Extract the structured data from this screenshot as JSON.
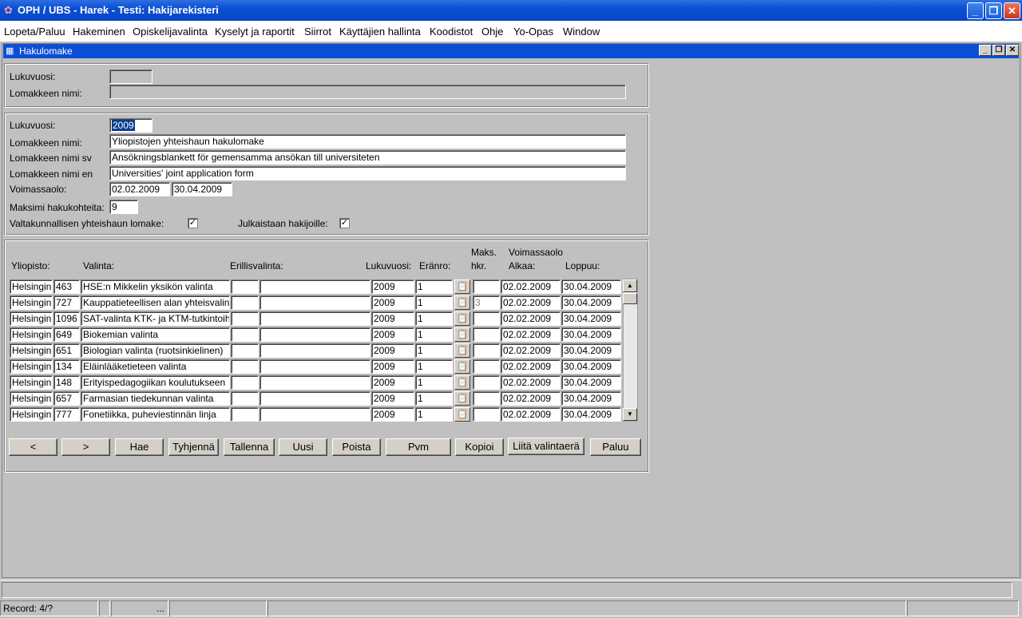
{
  "window": {
    "title": "OPH / UBS - Harek - Testi: Hakijarekisteri",
    "min_glyph": "_",
    "max_glyph": "❐",
    "close_glyph": "✕"
  },
  "menu": [
    "Lopeta/Paluu",
    "Hakeminen",
    "Opiskelijavalinta",
    "Kyselyt ja raportit",
    "Siirrot",
    "Käyttäjien hallinta",
    "Koodistot",
    "Ohje",
    "Yo-Opas",
    "Window"
  ],
  "form": {
    "title": "Hakulomake"
  },
  "search": {
    "lukuvuosi_label": "Lukuvuosi:",
    "lukuvuosi_value": "",
    "nimi_label": "Lomakkeen nimi:",
    "nimi_value": ""
  },
  "details": {
    "lukuvuosi_label": "Lukuvuosi:",
    "lukuvuosi_value": "2009",
    "nimi_label": "Lomakkeen nimi:",
    "nimi_value": "Yliopistojen yhteishaun hakulomake",
    "nimi_sv_label": "Lomakkeen nimi sv",
    "nimi_sv_value": "Ansökningsblankett för gemensamma ansökan till universiteten",
    "nimi_en_label": "Lomakkeen nimi en",
    "nimi_en_value": "Universities' joint application form",
    "voimassaolo_label": "Voimassaolo:",
    "voimassaolo_start": "02.02.2009",
    "voimassaolo_end": "30.04.2009",
    "maksimi_label": "Maksimi hakukohteita:",
    "maksimi_value": "9",
    "valtakunnallinen_label": "Valtakunnallisen yhteishaun lomake:",
    "valtakunnallinen_checked": true,
    "julkaistaan_label": "Julkaistaan hakijoille:",
    "julkaistaan_checked": true,
    "check_glyph": "✓"
  },
  "table": {
    "headers": {
      "yliopisto": "Yliopisto:",
      "valinta": "Valinta:",
      "erillisvalinta": "Erillisvalinta:",
      "lukuvuosi": "Lukuvuosi:",
      "eranro": "Eränro:",
      "maks1": "Maks.",
      "maks2": "hkr.",
      "voimassaolo": "Voimassaolo",
      "alkaa": "Alkaa:",
      "loppuu": "Loppuu:"
    },
    "lov_glyph": "📋",
    "rows": [
      {
        "yliopisto": "Helsingin",
        "koodi": "463",
        "valinta": "HSE:n Mikkelin yksikön valinta",
        "eril1": "",
        "eril2": "",
        "lukuvuosi": "2009",
        "eranro": "1",
        "maks": "",
        "alkaa": "02.02.2009",
        "loppuu": "30.04.2009"
      },
      {
        "yliopisto": "Helsingin",
        "koodi": "727",
        "valinta": "Kauppatieteellisen alan yhteisvalinta",
        "eril1": "",
        "eril2": "",
        "lukuvuosi": "2009",
        "eranro": "1",
        "maks": "3",
        "alkaa": "02.02.2009",
        "loppuu": "30.04.2009"
      },
      {
        "yliopisto": "Helsingin",
        "koodi": "1096",
        "valinta": "SAT-valinta KTK- ja KTM-tutkintoihin",
        "eril1": "",
        "eril2": "",
        "lukuvuosi": "2009",
        "eranro": "1",
        "maks": "",
        "alkaa": "02.02.2009",
        "loppuu": "30.04.2009"
      },
      {
        "yliopisto": "Helsingin",
        "koodi": "649",
        "valinta": "Biokemian valinta",
        "eril1": "",
        "eril2": "",
        "lukuvuosi": "2009",
        "eranro": "1",
        "maks": "",
        "alkaa": "02.02.2009",
        "loppuu": "30.04.2009"
      },
      {
        "yliopisto": "Helsingin",
        "koodi": "651",
        "valinta": "Biologian valinta (ruotsinkielinen)",
        "eril1": "",
        "eril2": "",
        "lukuvuosi": "2009",
        "eranro": "1",
        "maks": "",
        "alkaa": "02.02.2009",
        "loppuu": "30.04.2009"
      },
      {
        "yliopisto": "Helsingin",
        "koodi": "134",
        "valinta": "Eläinlääketieteen valinta",
        "eril1": "",
        "eril2": "",
        "lukuvuosi": "2009",
        "eranro": "1",
        "maks": "",
        "alkaa": "02.02.2009",
        "loppuu": "30.04.2009"
      },
      {
        "yliopisto": "Helsingin",
        "koodi": "148",
        "valinta": "Erityispedagogiikan koulutukseen",
        "eril1": "",
        "eril2": "",
        "lukuvuosi": "2009",
        "eranro": "1",
        "maks": "",
        "alkaa": "02.02.2009",
        "loppuu": "30.04.2009"
      },
      {
        "yliopisto": "Helsingin",
        "koodi": "657",
        "valinta": "Farmasian tiedekunnan valinta",
        "eril1": "",
        "eril2": "",
        "lukuvuosi": "2009",
        "eranro": "1",
        "maks": "",
        "alkaa": "02.02.2009",
        "loppuu": "30.04.2009"
      },
      {
        "yliopisto": "Helsingin",
        "koodi": "777",
        "valinta": "Fonetiikka, puheviestinnän linja",
        "eril1": "",
        "eril2": "",
        "lukuvuosi": "2009",
        "eranro": "1",
        "maks": "",
        "alkaa": "02.02.2009",
        "loppuu": "30.04.2009"
      }
    ],
    "scroll_up": "▲",
    "scroll_down": "▼"
  },
  "buttons": [
    "<",
    ">",
    "Hae",
    "Tyhjennä",
    "Tallenna",
    "Uusi",
    "Poista",
    "Pvm",
    "Kopioi",
    "Liitä valintaerä",
    "Paluu"
  ],
  "status": {
    "record": "Record: 4/?",
    "seg3": "..."
  },
  "colors": {
    "titlebar": "#0a4fd6",
    "background": "#c0c0c0",
    "selection": "#0a3d8f"
  }
}
